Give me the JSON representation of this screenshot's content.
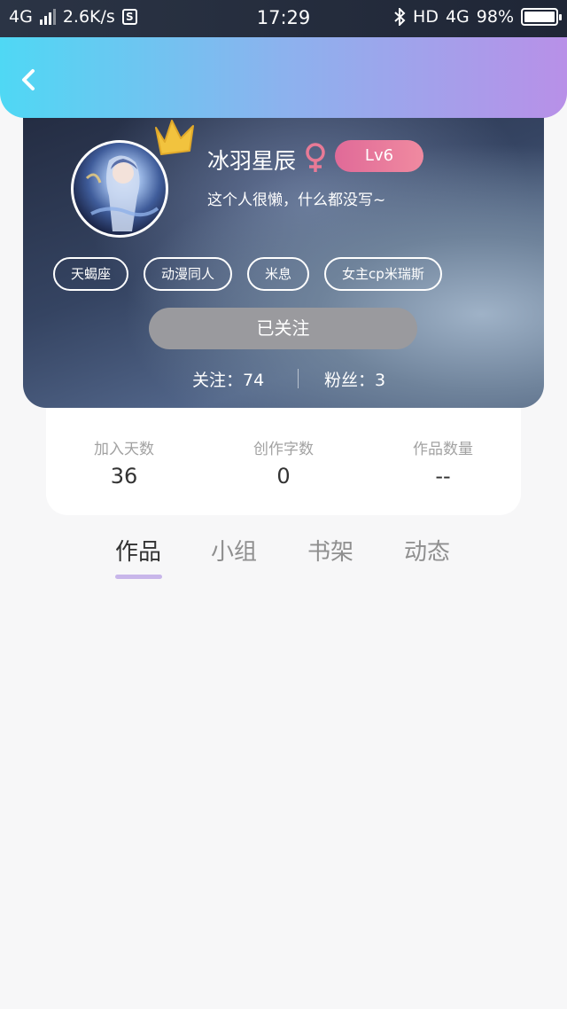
{
  "status_bar": {
    "network": "4G",
    "speed": "2.6K/s",
    "time": "17:29",
    "hd": "HD",
    "network_right": "4G",
    "battery": "98%"
  },
  "header": {
    "back_icon": "chevron-left-icon"
  },
  "profile": {
    "username": "冰羽星辰",
    "gender_symbol": "♀",
    "level": "Lv6",
    "bio": "这个人很懒，什么都没写~",
    "tags": [
      "天蝎座",
      "动漫同人",
      "米息",
      "女主cp米瑞斯"
    ],
    "follow_button": "已关注",
    "following": "关注：74",
    "fans": "粉丝：3"
  },
  "stats": [
    {
      "label": "加入天数",
      "value": "36"
    },
    {
      "label": "创作字数",
      "value": "0"
    },
    {
      "label": "作品数量",
      "value": "--"
    }
  ],
  "tabs": [
    {
      "label": "作品",
      "active": true
    },
    {
      "label": "小组",
      "active": false
    },
    {
      "label": "书架",
      "active": false
    },
    {
      "label": "动态",
      "active": false
    }
  ],
  "colors": {
    "header_gradient": [
      "#4fd8f4",
      "#b890e8"
    ],
    "level_badge": "#e06a98",
    "gender": "#e87a96",
    "crown": "#f2c33e",
    "tab_indicator": "#c8b6ea",
    "follow_button": "#9a9a9e"
  }
}
